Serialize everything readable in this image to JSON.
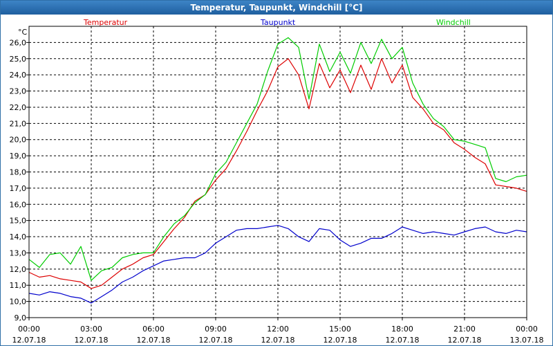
{
  "window": {
    "title": "Temperatur, Taupunkt, Windchill [°C]"
  },
  "chart_data": {
    "type": "line",
    "title": "Temperatur, Taupunkt, Windchill [°C]",
    "ylabel": "°C",
    "xlabel": "",
    "ylim": [
      9.0,
      27.0
    ],
    "xlim": [
      0,
      24
    ],
    "grid": true,
    "y_ticks": [
      "9,0",
      "10,0",
      "11,0",
      "12,0",
      "13,0",
      "14,0",
      "15,0",
      "16,0",
      "17,0",
      "18,0",
      "19,0",
      "20,0",
      "21,0",
      "22,0",
      "23,0",
      "24,0",
      "25,0",
      "26,0"
    ],
    "x_ticks": [
      {
        "time": "00:00",
        "date": "12.07.18"
      },
      {
        "time": "03:00",
        "date": "12.07.18"
      },
      {
        "time": "06:00",
        "date": "12.07.18"
      },
      {
        "time": "09:00",
        "date": "12.07.18"
      },
      {
        "time": "12:00",
        "date": "12.07.18"
      },
      {
        "time": "15:00",
        "date": "12.07.18"
      },
      {
        "time": "18:00",
        "date": "12.07.18"
      },
      {
        "time": "21:00",
        "date": "12.07.18"
      },
      {
        "time": "00:00",
        "date": "13.07.18"
      }
    ],
    "x": [
      0,
      0.5,
      1,
      1.5,
      2,
      2.5,
      3,
      3.5,
      4,
      4.5,
      5,
      5.5,
      6,
      6.5,
      7,
      7.5,
      8,
      8.5,
      9,
      9.5,
      10,
      10.5,
      11,
      11.5,
      12,
      12.5,
      13,
      13.5,
      14,
      14.5,
      15,
      15.5,
      16,
      16.5,
      17,
      17.5,
      18,
      18.5,
      19,
      19.5,
      20,
      20.5,
      21,
      21.5,
      22,
      22.5,
      23,
      23.5,
      24
    ],
    "series": [
      {
        "name": "Temperatur",
        "color": "#dd0000",
        "legend_pos": "top-left",
        "values": [
          11.8,
          11.5,
          11.6,
          11.4,
          11.3,
          11.2,
          10.8,
          11.0,
          11.5,
          12.0,
          12.3,
          12.7,
          12.9,
          13.7,
          14.5,
          15.2,
          16.2,
          16.6,
          17.5,
          18.2,
          19.3,
          20.5,
          21.8,
          23.0,
          24.5,
          25.0,
          24.0,
          21.9,
          24.7,
          23.2,
          24.3,
          22.9,
          24.6,
          23.1,
          25.0,
          23.5,
          24.6,
          22.6,
          21.9,
          21.0,
          20.6,
          19.8,
          19.4,
          18.9,
          18.5,
          17.2,
          17.1,
          17.0,
          16.8
        ]
      },
      {
        "name": "Taupunkt",
        "color": "#0000cc",
        "legend_pos": "top-center",
        "values": [
          10.5,
          10.4,
          10.6,
          10.5,
          10.3,
          10.2,
          9.9,
          10.3,
          10.7,
          11.2,
          11.5,
          11.9,
          12.2,
          12.5,
          12.6,
          12.7,
          12.7,
          13.0,
          13.6,
          14.0,
          14.4,
          14.5,
          14.5,
          14.6,
          14.7,
          14.5,
          14.0,
          13.7,
          14.5,
          14.4,
          13.8,
          13.4,
          13.6,
          13.9,
          13.9,
          14.2,
          14.6,
          14.4,
          14.2,
          14.3,
          14.2,
          14.1,
          14.3,
          14.5,
          14.6,
          14.3,
          14.2,
          14.4,
          14.3
        ]
      },
      {
        "name": "Windchill",
        "color": "#00cc00",
        "legend_pos": "top-right",
        "values": [
          12.6,
          12.1,
          12.9,
          13.0,
          12.3,
          13.4,
          11.3,
          11.9,
          12.1,
          12.7,
          12.9,
          13.0,
          13.0,
          14.0,
          14.8,
          15.3,
          16.1,
          16.6,
          17.9,
          18.6,
          19.8,
          21.0,
          22.2,
          24.2,
          25.9,
          26.3,
          25.7,
          22.5,
          25.9,
          24.2,
          25.4,
          24.1,
          26.0,
          24.7,
          26.2,
          25.0,
          25.7,
          23.5,
          22.2,
          21.3,
          20.8,
          20.0,
          19.9,
          19.7,
          19.5,
          17.6,
          17.4,
          17.7,
          17.8
        ]
      }
    ]
  }
}
